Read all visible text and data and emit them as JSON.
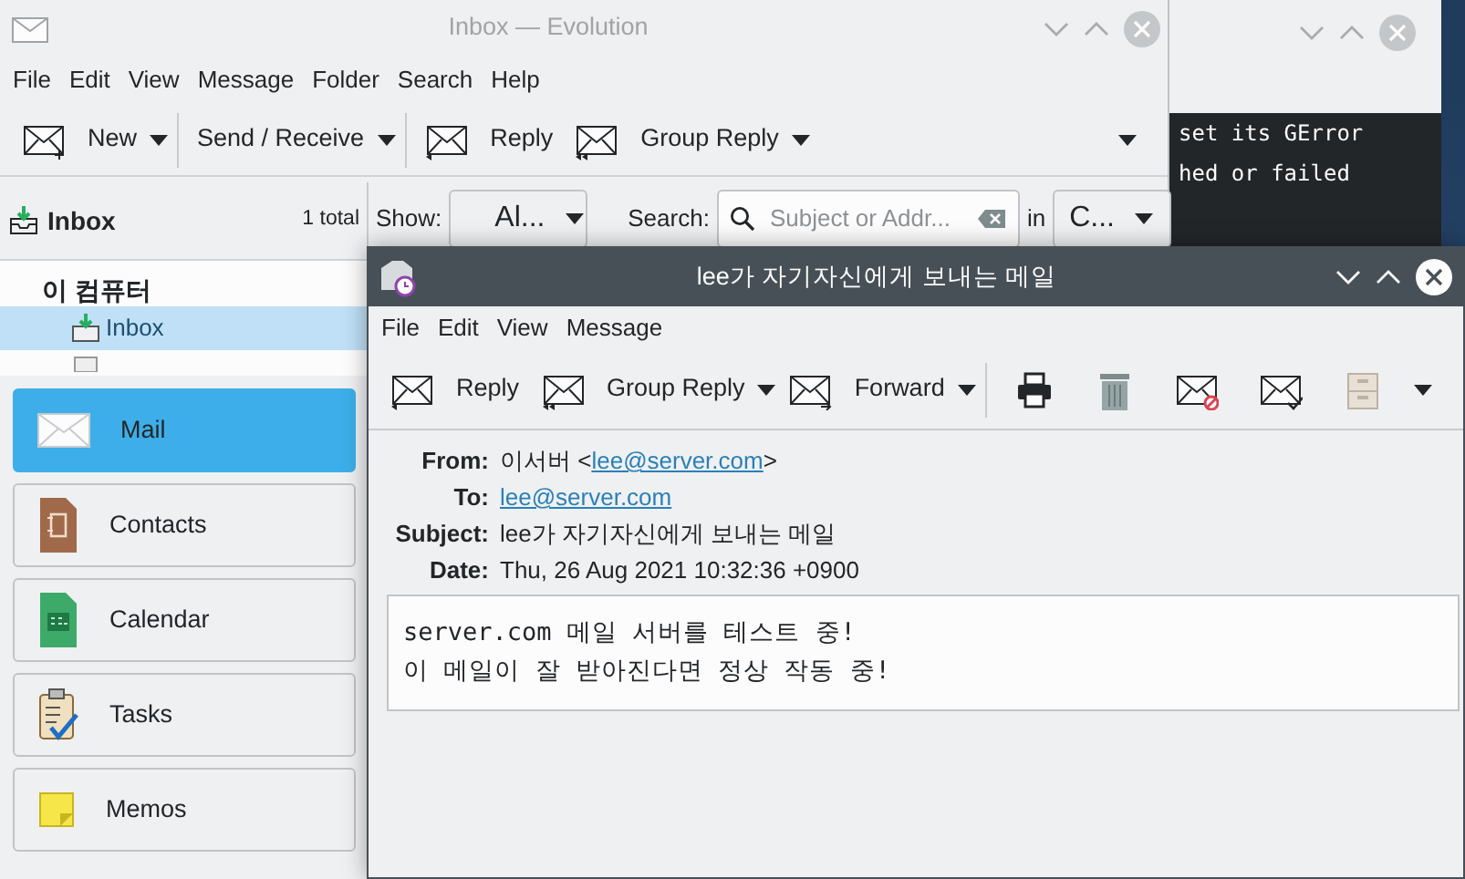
{
  "terminal": {
    "lines": [
      "set its GError",
      "hed or failed"
    ]
  },
  "main_window": {
    "title": "Inbox — Evolution",
    "menu": [
      "File",
      "Edit",
      "View",
      "Message",
      "Folder",
      "Search",
      "Help"
    ],
    "toolbar": [
      {
        "kind": "new",
        "label": "New",
        "dropdown": true
      },
      {
        "kind": "sendreceive",
        "label": "Send / Receive",
        "dropdown": true
      },
      {
        "kind": "reply",
        "label": "Reply",
        "dropdown": false
      },
      {
        "kind": "groupreply",
        "label": "Group Reply",
        "dropdown": true
      }
    ],
    "folder_header": {
      "title": "Inbox",
      "count": "1 total"
    },
    "filter": {
      "show_label": "Show:",
      "show_value": "Al...",
      "search_label": "Search:",
      "search_placeholder": "Subject or Addr...",
      "in_label": "in",
      "in_value": "C..."
    },
    "folders": {
      "account": "이 컴퓨터",
      "items": [
        {
          "label": "Inbox",
          "selected": true
        }
      ]
    },
    "switcher": [
      {
        "kind": "mail",
        "label": "Mail",
        "selected": true
      },
      {
        "kind": "contacts",
        "label": "Contacts",
        "selected": false
      },
      {
        "kind": "calendar",
        "label": "Calendar",
        "selected": false
      },
      {
        "kind": "tasks",
        "label": "Tasks",
        "selected": false
      },
      {
        "kind": "memos",
        "label": "Memos",
        "selected": false
      }
    ]
  },
  "message_window": {
    "title": "lee가 자기자신에게 보내는 메일",
    "menu": [
      "File",
      "Edit",
      "View",
      "Message"
    ],
    "toolbar": [
      {
        "kind": "reply",
        "label": "Reply",
        "dropdown": false
      },
      {
        "kind": "groupreply",
        "label": "Group Reply",
        "dropdown": true
      },
      {
        "kind": "forward",
        "label": "Forward",
        "dropdown": true
      },
      {
        "kind": "print"
      },
      {
        "kind": "delete"
      },
      {
        "kind": "junk"
      },
      {
        "kind": "notjunk"
      },
      {
        "kind": "archive"
      }
    ],
    "headers": [
      {
        "label": "From:",
        "parts": [
          {
            "text": "이서버 <"
          },
          {
            "link": "lee@server.com"
          },
          {
            "text": ">"
          }
        ]
      },
      {
        "label": "To:",
        "parts": [
          {
            "link": "lee@server.com"
          }
        ]
      },
      {
        "label": "Subject:",
        "parts": [
          {
            "text": "lee가 자기자신에게 보내는 메일"
          }
        ]
      },
      {
        "label": "Date:",
        "parts": [
          {
            "text": "Thu, 26 Aug 2021 10:32:36 +0900"
          }
        ]
      }
    ],
    "body": [
      "server.com 메일 서버를 테스트 중!",
      "이 메일이 잘 받아진다면 정상 작동 중!"
    ]
  }
}
